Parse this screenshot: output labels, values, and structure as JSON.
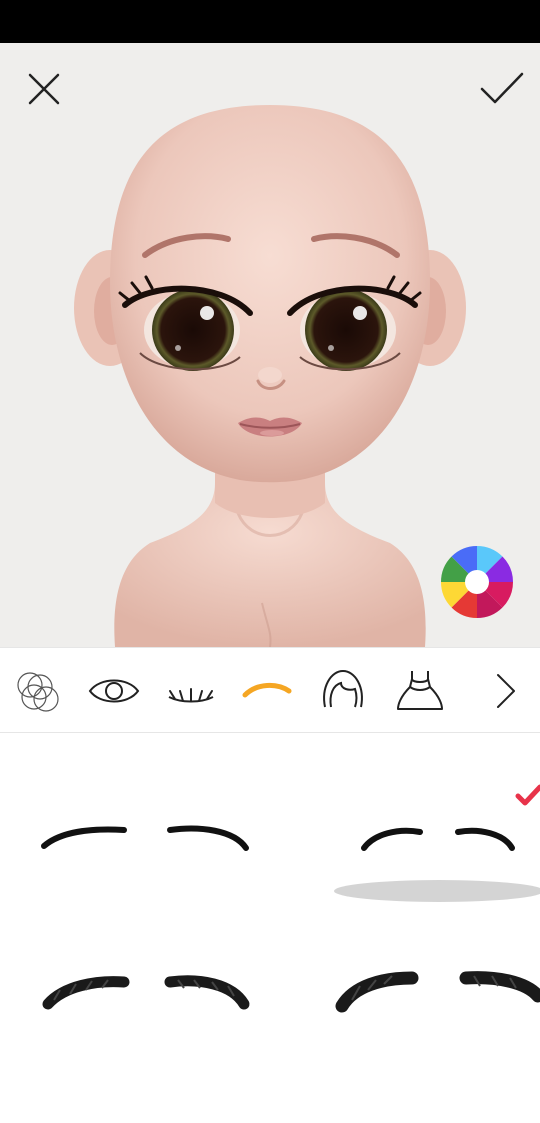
{
  "screen": "eyebrow-editor",
  "header": {
    "close_icon": "close-icon",
    "confirm_icon": "check-icon"
  },
  "color_picker": {
    "icon": "color-wheel-icon",
    "segments": [
      "#5ac8fa",
      "#4a6cf7",
      "#8a2be2",
      "#d81b60",
      "#e53935",
      "#f4511e",
      "#fdd835",
      "#43a047"
    ]
  },
  "toolbar": {
    "items": [
      {
        "id": "skin-tone",
        "icon": "overlapping-circles-icon",
        "active": false
      },
      {
        "id": "eyes",
        "icon": "eye-icon",
        "active": false
      },
      {
        "id": "lashes",
        "icon": "eyelashes-icon",
        "active": false
      },
      {
        "id": "eyebrows",
        "icon": "eyebrow-icon",
        "active": true
      },
      {
        "id": "hair",
        "icon": "hair-icon",
        "active": false
      },
      {
        "id": "dress",
        "icon": "dress-icon",
        "active": false
      },
      {
        "id": "more",
        "icon": "chevron-right-icon",
        "active": false
      }
    ],
    "active_color": "#f5a623"
  },
  "eyebrow_options": [
    {
      "style": "thin-arched",
      "selected": false
    },
    {
      "style": "thin-short",
      "selected": true
    },
    {
      "style": "thick-textured",
      "selected": false
    },
    {
      "style": "bold-arched",
      "selected": false
    }
  ],
  "selection_color": "#e8334a"
}
